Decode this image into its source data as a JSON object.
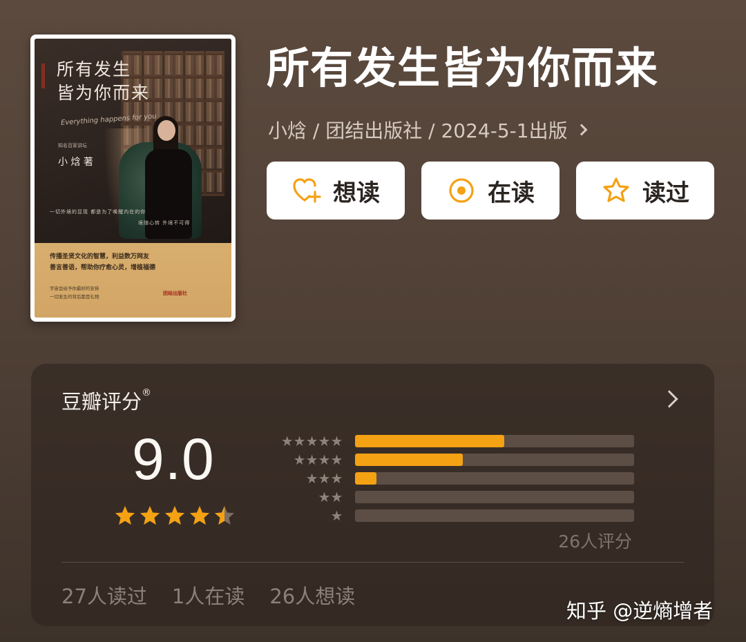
{
  "book": {
    "title": "所有发生皆为你而来",
    "meta": "小焓 / 团结出版社 / 2024-5-1出版"
  },
  "cover": {
    "title_line1": "所有发生",
    "title_line2": "皆为你而来",
    "spine_text": "所有发生皆为你而来",
    "script_text": "Everything happens for you",
    "author_small": "知名百家讲坛",
    "author": "小 焓  著",
    "tagline": "一切外境的显现 都是为了唤醒内在的你",
    "tagline2": "境随心转 外境不可得",
    "band_line1": "传播圣贤文化的智慧，利益数万网友",
    "band_line2": "善言善语，帮助你疗愈心灵，增植福德",
    "band_small1": "宇宙会给予你最好的安排",
    "band_small2": "一切发生的背后都是礼物",
    "publisher": "团结出版社"
  },
  "actions": [
    {
      "label": "想读",
      "icon": "heart-plus-icon"
    },
    {
      "label": "在读",
      "icon": "target-circle-icon"
    },
    {
      "label": "读过",
      "icon": "star-outline-icon"
    }
  ],
  "rating": {
    "title": "豆瓣评分",
    "registered": "®",
    "score": "9.0",
    "star_value": 4.5,
    "count_label": "26人评分",
    "distribution": [
      {
        "stars": 5,
        "fraction": 0.535
      },
      {
        "stars": 4,
        "fraction": 0.385
      },
      {
        "stars": 3,
        "fraction": 0.077
      },
      {
        "stars": 2,
        "fraction": 0
      },
      {
        "stars": 1,
        "fraction": 0
      }
    ],
    "stats": {
      "read": "27人读过",
      "reading": "1人在读",
      "want": "26人想读"
    }
  },
  "watermark": "知乎 @逆熵增者",
  "colors": {
    "accent": "#f4a114",
    "background": "#5c4a3e",
    "card": "#3a2e27",
    "button_bg": "#ffffff"
  }
}
